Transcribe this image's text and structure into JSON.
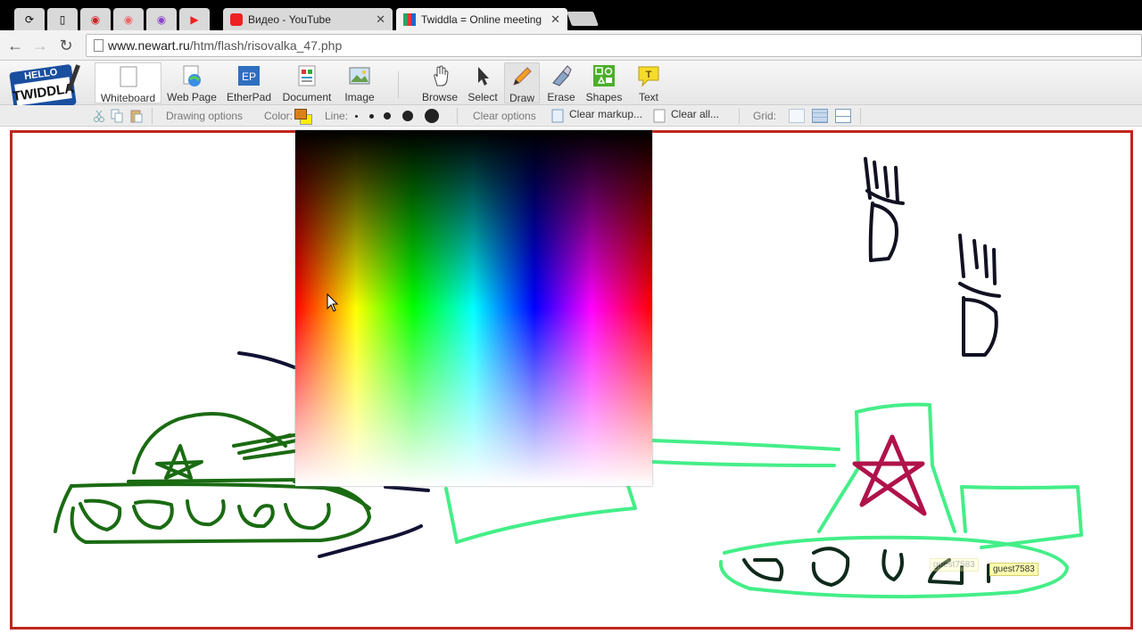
{
  "browser": {
    "tabs": [
      {
        "title": "Видео - YouTube",
        "icon": "youtube-icon",
        "active": false
      },
      {
        "title": "Twiddla = Online meeting",
        "icon": "twiddla-icon",
        "active": true
      }
    ],
    "url_domain": "www.newart.ru",
    "url_path": "/htm/flash/risovalka_47.php"
  },
  "toolbar": {
    "tools": [
      {
        "label": "Whiteboard",
        "icon": "whiteboard-icon"
      },
      {
        "label": "Web Page",
        "icon": "web-page-icon"
      },
      {
        "label": "EtherPad",
        "icon": "etherpad-icon"
      },
      {
        "label": "Document",
        "icon": "document-icon"
      },
      {
        "label": "Image",
        "icon": "image-icon"
      },
      {
        "label": "Browse",
        "icon": "hand-icon"
      },
      {
        "label": "Select",
        "icon": "arrow-icon"
      },
      {
        "label": "Draw",
        "icon": "pencil-icon"
      },
      {
        "label": "Erase",
        "icon": "eraser-icon"
      },
      {
        "label": "Shapes",
        "icon": "shapes-icon"
      },
      {
        "label": "Text",
        "icon": "text-icon"
      }
    ],
    "etherpad_badge": "EP",
    "text_badge": "T",
    "selected_tool": "Draw"
  },
  "subbar": {
    "drawing_options": "Drawing options",
    "color_label": "Color:",
    "line_label": "Line:",
    "clear_options": "Clear options",
    "clear_markup": "Clear markup...",
    "clear_all": "Clear all...",
    "grid_label": "Grid:",
    "current_color": "#d9801a",
    "secondary_color": "#ffee00"
  },
  "canvas": {
    "guest_tags": [
      "guest7583",
      "guest7583"
    ]
  },
  "colors": {
    "border": "#c0261c",
    "tank_left": "#1a6b12",
    "tank_right": "#44ee88",
    "star_right": "#b0124a",
    "ink": "#111133"
  }
}
